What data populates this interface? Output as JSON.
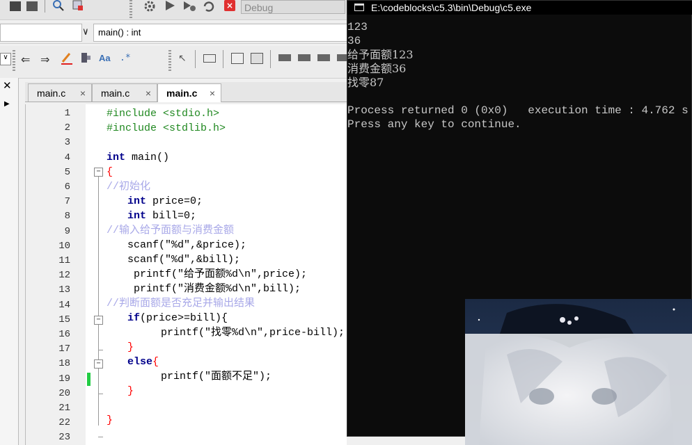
{
  "toolbar": {
    "build_target": "Debug",
    "function_scope": "main() : int"
  },
  "tabs": [
    {
      "label": "main.c",
      "close": "×"
    },
    {
      "label": "main.c",
      "close": "×"
    },
    {
      "label": "main.c",
      "close": "×"
    }
  ],
  "editor": {
    "line_numbers": [
      "1",
      "2",
      "3",
      "4",
      "5",
      "6",
      "7",
      "8",
      "9",
      "10",
      "11",
      "12",
      "13",
      "14",
      "15",
      "16",
      "17",
      "18",
      "19",
      "20",
      "21",
      "22",
      "23"
    ]
  },
  "code": {
    "l1": "#include <stdio.h>",
    "l2": "#include <stdlib.h>",
    "l4_kw": "int",
    "l4_rest": " main()",
    "l5": "{",
    "l6": "//初始化",
    "l7_kw": "int",
    "l7_rest": " price=0;",
    "l8_kw": "int",
    "l8_rest": " bill=0;",
    "l9": "//输入给予面额与消费金额",
    "l10": "scanf(\"%d\",&price);",
    "l11": "scanf(\"%d\",&bill);",
    "l12": "printf(\"给予面额%d\\n\",price);",
    "l13": "printf(\"消费金额%d\\n\",bill);",
    "l14": "//判断面额是否充足并输出结果",
    "l15_kw": "if",
    "l15_rest": "(price>=bill){",
    "l16": "printf(\"找零%d\\n\",price-bill);",
    "l17": "}",
    "l18_kw": "else",
    "l18_rest": "{",
    "l19": "printf(\"面额不足\");",
    "l20": "}",
    "l22": "}"
  },
  "console": {
    "title": "E:\\codeblocks\\c5.3\\bin\\Debug\\c5.exe",
    "lines": [
      "123",
      "36",
      "给予面额123",
      "消费金额36",
      "找零87",
      "",
      "Process returned 0 (0x0)   execution time : 4.762 s",
      "Press any key to continue."
    ]
  },
  "colors": {
    "keyword": "#00008b",
    "preprocessor": "#208820",
    "comment": "#a8a8e8",
    "string": "#0000ff",
    "number": "#f000f0",
    "operator": "#ff0000",
    "console_bg": "#0c0c0c",
    "console_text": "#c8c8c8",
    "changebar": "#22cc44"
  }
}
